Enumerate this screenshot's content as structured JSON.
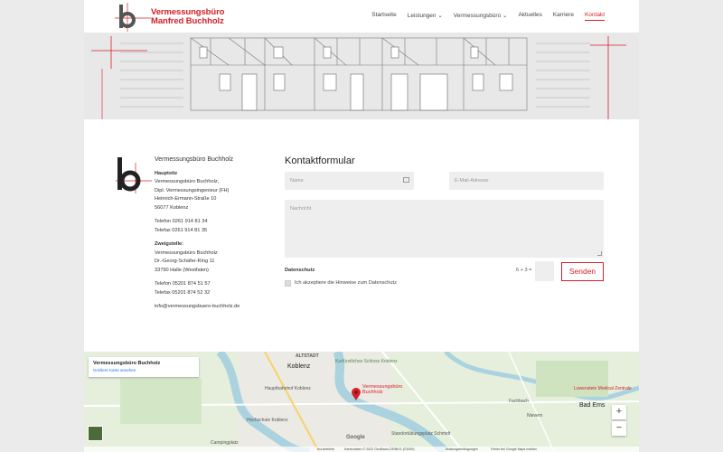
{
  "header": {
    "logo_line1": "Vermessungsbüro",
    "logo_line2": "Manfred Buchholz",
    "nav": [
      "Startseite",
      "Leistungen",
      "Vermessungsbüro",
      "Aktuelles",
      "Karriere",
      "Kontakt"
    ],
    "active": "Kontakt"
  },
  "address": {
    "firm": "Vermessungsbüro Buchholz",
    "hq_label": "Hauptsitz",
    "hq_lines": [
      "Vermessungsbüro Buchholz,",
      "Dipl. Vermessungsingenieur (FH)",
      "Heinrich-Ermann-Straße 10",
      "56077 Koblenz"
    ],
    "hq_phone": "Telefon 0261 914 81 34",
    "hq_fax": "Telefax 0261 914 81 35",
    "branch_label": "Zweigstelle:",
    "branch_lines": [
      "Vermessungsbüro Buchholz",
      "Dr.-Georg-Schäfer-Ring 11",
      "33790 Halle (Westfalen)"
    ],
    "branch_phone": "Telefon 05201 874 51 57",
    "branch_fax": "Telefax 05201 874 52 32",
    "email": "info@vermessungsbuero-buchholz.de"
  },
  "form": {
    "title": "Kontaktformular",
    "name_placeholder": "Name",
    "email_placeholder": "E-Mail-Adresse",
    "message_placeholder": "Nachricht",
    "privacy_label": "Datenschutz",
    "captcha": "6 + 3 =",
    "send": "Senden",
    "consent": "Ich akzeptiere die Hinweise zum Datenschutz"
  },
  "map": {
    "card_title": "Vermessungsbüro Buchholz",
    "card_link": "Größere Karte ansehen",
    "marker_line1": "Vermessungsbüro",
    "marker_line2": "Buchholz",
    "labels": [
      "ALTSTADT",
      "Koblenz",
      "Kurfürstliches Schloss Koblenz",
      "Hauptbahnhof Koblenz",
      "Hochschule Koblenz",
      "Fachbach",
      "Bad Ems",
      "Nievern",
      "Lowenstein Medical Zentrale",
      "Campingplatz",
      "Standortübungsplatz Schmidt"
    ],
    "google": "Google",
    "footer": [
      "Kurzbefehle",
      "Kartendaten © 2022 GeoBasis-DE/BKG (©2009)",
      "Nutzungsbedingungen",
      "Fehler bei Google Maps melden"
    ],
    "zoom_in": "+",
    "zoom_out": "−"
  },
  "colors": {
    "accent": "#d41f26"
  }
}
